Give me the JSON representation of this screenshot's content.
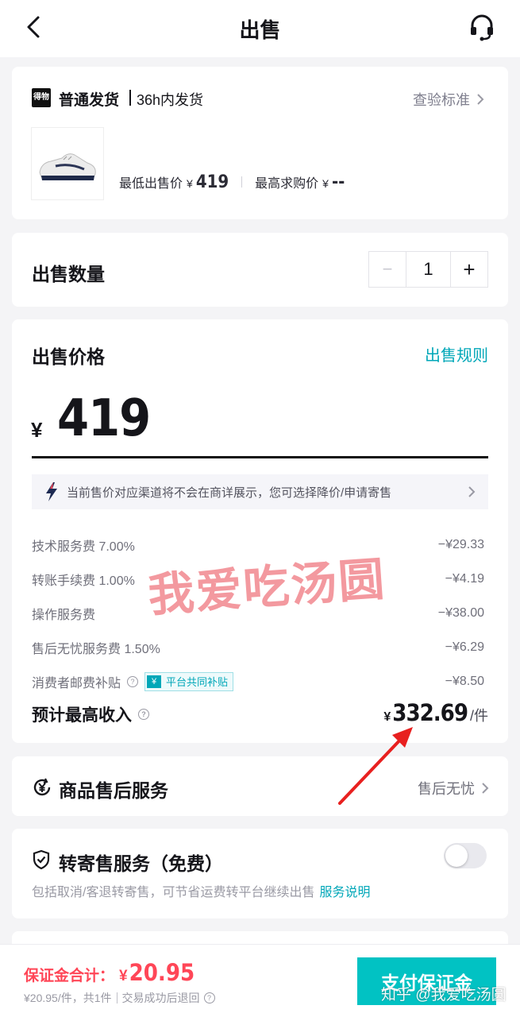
{
  "nav": {
    "title": "出售"
  },
  "product": {
    "brand_logo_text": "得物",
    "ship_type": "普通发货",
    "ship_time": "36h内发货",
    "inspect_link": "查验标准",
    "lowest_label": "最低出售价",
    "lowest_yen": "¥",
    "lowest_value": "419",
    "highest_label": "最高求购价",
    "highest_yen": "¥",
    "highest_value": "--"
  },
  "quantity": {
    "label": "出售数量",
    "minus": "−",
    "value": "1",
    "plus": "+"
  },
  "price": {
    "label": "出售价格",
    "rules_link": "出售规则",
    "currency": "¥",
    "value": "419",
    "notice": "当前售价对应渠道将不会在商详展示，您可选择降价/申请寄售",
    "fees": [
      {
        "label": "技术服务费 7.00%",
        "amount": "−¥29.33"
      },
      {
        "label": "转账手续费 1.00%",
        "amount": "−¥4.19"
      },
      {
        "label": "操作服务费",
        "amount": "−¥38.00"
      },
      {
        "label": "售后无忧服务费 1.50%",
        "amount": "−¥6.29"
      },
      {
        "label": "消费者邮费补贴",
        "amount": "−¥8.50",
        "tag": "平台共同补贴",
        "tag_icon": "¥"
      }
    ],
    "income_label": "预计最高收入",
    "income_yen": "¥",
    "income_value": "332.69",
    "income_unit": "/件"
  },
  "service": {
    "label": "商品售后服务",
    "value": "售后无忧"
  },
  "consign": {
    "label": "转寄售服务（免费）",
    "description": "包括取消/客退转寄售，可节省运费转平台继续出售",
    "link": "服务说明",
    "enabled": false
  },
  "bottom": {
    "deposit_label": "保证金合计：",
    "deposit_yen": "¥",
    "deposit_value": "20.95",
    "deposit_detail": "¥20.95/件，共1件",
    "refund_note": "交易成功后退回",
    "pay_button": "支付保证金"
  },
  "watermarks": {
    "stamp": "我爱吃汤圆",
    "corner": "知乎 @我爱吃汤圆"
  },
  "colors": {
    "accent": "#01a7b8",
    "pay_button": "#01c2c3",
    "deposit_red": "#ff4657",
    "stamp_red": "#ee6e76",
    "arrow_red": "#e8201f"
  }
}
